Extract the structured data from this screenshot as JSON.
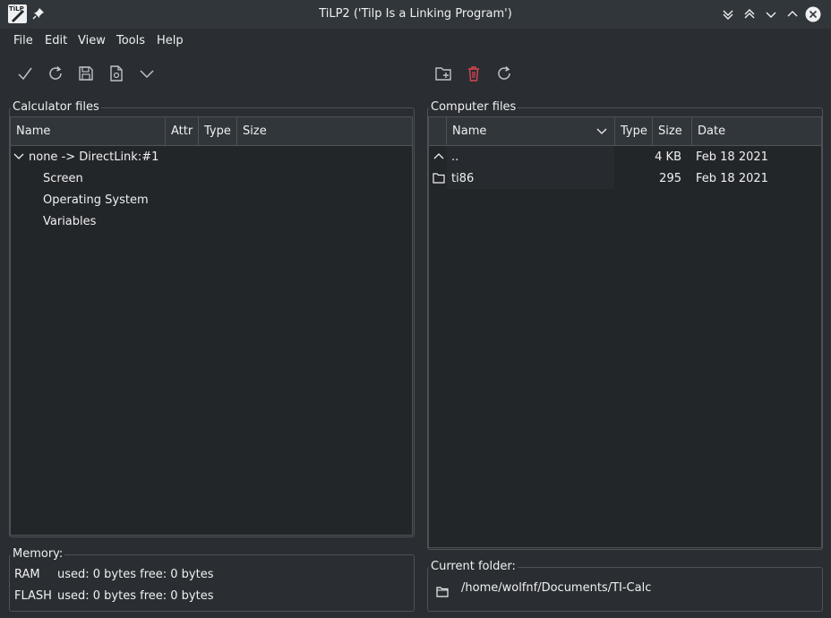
{
  "window": {
    "title": "TiLP2 ('Tilp Is a Linking Program')",
    "app_icon_text": "TiLP"
  },
  "menu": [
    "File",
    "Edit",
    "View",
    "Tools",
    "Help"
  ],
  "calculator_files": {
    "group_title": "Calculator files",
    "columns": [
      "Name",
      "Attr",
      "Type",
      "Size"
    ],
    "root": "none -> DirectLink:#1",
    "children": [
      "Screen",
      "Operating System",
      "Variables"
    ]
  },
  "computer_files": {
    "group_title": "Computer files",
    "columns": [
      "Name",
      "Type",
      "Size",
      "Date"
    ],
    "rows": [
      {
        "name": "..",
        "type": "",
        "size": "4 KB",
        "date": "Feb 18 2021"
      },
      {
        "name": "ti86",
        "type": "",
        "size": "295",
        "date": "Feb 18 2021"
      }
    ]
  },
  "memory": {
    "group_title": "Memory:",
    "ram_label": "RAM",
    "ram_value": "used: 0 bytes free: 0 bytes",
    "flash_label": "FLASH",
    "flash_value": "used: 0 bytes free: 0 bytes"
  },
  "current_folder": {
    "group_title": "Current folder:",
    "path": "/home/wolfnf/Documents/TI-Calc"
  },
  "colors": {
    "background": "#2a2e32",
    "panel": "#232629",
    "border": "#4d5257",
    "delete_icon": "#da4453"
  }
}
